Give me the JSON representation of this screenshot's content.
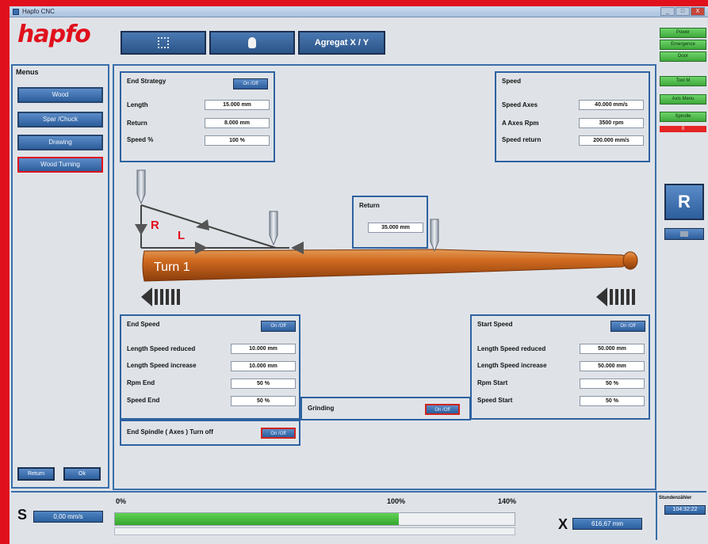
{
  "window": {
    "title": "Hapfo CNC",
    "controls": [
      "_",
      "□",
      "X"
    ]
  },
  "logo": "hapfo",
  "toolbar": {
    "aggregate_label": "Agregat X / Y"
  },
  "status_buttons": [
    "Power",
    "Emergence",
    "Door",
    "Tool M",
    "Axis Menu",
    "Spindle"
  ],
  "status_indicator": "0",
  "r_button": "R",
  "menu": {
    "title": "Menus",
    "items": [
      "Wood",
      "Spar /Chuck",
      "Drawing",
      "Wood Turning"
    ],
    "return_label": "Return",
    "ok_label": "Ok"
  },
  "end_strategy": {
    "title": "End Strategy",
    "onoff": "On /Off",
    "fields": [
      {
        "label": "Length",
        "value": "15.000 mm"
      },
      {
        "label": "Return",
        "value": "8.000 mm"
      },
      {
        "label": "Speed %",
        "value": "100 %"
      }
    ]
  },
  "speed": {
    "title": "Speed",
    "fields": [
      {
        "label": "Speed Axes",
        "value": "40.000 mm/s"
      },
      {
        "label": "A Axes Rpm",
        "value": "3500 rpm"
      },
      {
        "label": "Speed return",
        "value": "200.000 mm/s"
      }
    ]
  },
  "return_box": {
    "title": "Return",
    "value": "35.000 mm"
  },
  "drawing": {
    "turn_label": "Turn 1",
    "r_label": "R",
    "l_label": "L"
  },
  "end_speed": {
    "title": "End Speed",
    "onoff": "On /Off",
    "fields": [
      {
        "label": "Length Speed reduced",
        "value": "10.000 mm"
      },
      {
        "label": "Length Speed increase",
        "value": "10.000 mm"
      },
      {
        "label": "Rpm End",
        "value": "50 %"
      },
      {
        "label": "Speed End",
        "value": "50 %"
      }
    ]
  },
  "grinding": {
    "title": "Grinding",
    "onoff": "On /Off"
  },
  "end_spindle": {
    "title": "End Spindle ( Axes ) Turn off",
    "onoff": "On /Off"
  },
  "start_speed": {
    "title": "Start Speed",
    "onoff": "On /Off",
    "fields": [
      {
        "label": "Length Speed reduced",
        "value": "50.000 mm"
      },
      {
        "label": "Length Speed increase",
        "value": "50.000 mm"
      },
      {
        "label": "Rpm Start",
        "value": "50 %"
      },
      {
        "label": "Speed Start",
        "value": "50 %"
      }
    ]
  },
  "bottom": {
    "s_letter": "S",
    "s_value": "0,00 mm/s",
    "pct_0": "0%",
    "pct_100": "100%",
    "pct_140": "140%",
    "progress_fraction": 0.71,
    "x_letter": "X",
    "x_value": "616,67 mm",
    "operating_label": "Stundenzähler",
    "operating_value": "104:32:22"
  },
  "colors": {
    "accent_red": "#e0101c",
    "button_blue": "#2d5e9c",
    "status_green": "#3fa83b",
    "bat_orange": "#c9651d"
  }
}
